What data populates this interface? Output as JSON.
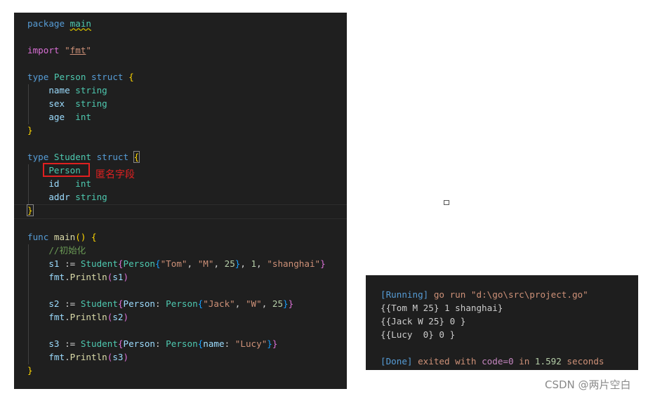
{
  "editor": {
    "lines": [
      [
        [
          "package ",
          "kw"
        ],
        [
          "main",
          "ty sq"
        ]
      ],
      [],
      [
        [
          "import ",
          "b2"
        ],
        [
          "\"",
          "st"
        ],
        [
          "fmt",
          "st ul"
        ],
        [
          "\"",
          "st"
        ]
      ],
      [],
      [
        [
          "type ",
          "kw"
        ],
        [
          "Person ",
          "ty"
        ],
        [
          "struct ",
          "kw"
        ],
        [
          "{",
          "b1"
        ]
      ],
      [
        [
          "    name ",
          "va"
        ],
        [
          "string",
          "ty"
        ]
      ],
      [
        [
          "    sex  ",
          "va"
        ],
        [
          "string",
          "ty"
        ]
      ],
      [
        [
          "    age  ",
          "va"
        ],
        [
          "int",
          "ty"
        ]
      ],
      [
        [
          "}",
          "b1"
        ]
      ],
      [],
      [
        [
          "type ",
          "kw"
        ],
        [
          "Student ",
          "ty"
        ],
        [
          "struct ",
          "kw"
        ],
        [
          "{",
          "b1 mb"
        ]
      ],
      [
        [
          "    Person",
          "ty"
        ]
      ],
      [
        [
          "    id   ",
          "va"
        ],
        [
          "int",
          "ty"
        ]
      ],
      [
        [
          "    addr ",
          "va"
        ],
        [
          "string",
          "ty"
        ]
      ],
      [
        [
          "}",
          "b1 mb"
        ]
      ],
      [],
      [
        [
          "func ",
          "kw"
        ],
        [
          "main",
          "fn"
        ],
        [
          "()",
          "b1"
        ],
        [
          " {",
          "b1"
        ]
      ],
      [
        [
          "    //初始化",
          "cm"
        ]
      ],
      [
        [
          "    s1 ",
          "va"
        ],
        [
          ":= ",
          "pl"
        ],
        [
          "Student",
          "ty"
        ],
        [
          "{",
          "b2"
        ],
        [
          "Person",
          "ty"
        ],
        [
          "{",
          "b3"
        ],
        [
          "\"Tom\"",
          "st"
        ],
        [
          ", ",
          "pl"
        ],
        [
          "\"M\"",
          "st"
        ],
        [
          ", ",
          "pl"
        ],
        [
          "25",
          "nu"
        ],
        [
          "}",
          "b3"
        ],
        [
          ", ",
          "pl"
        ],
        [
          "1",
          "nu"
        ],
        [
          ", ",
          "pl"
        ],
        [
          "\"shanghai\"",
          "st"
        ],
        [
          "}",
          "b2"
        ]
      ],
      [
        [
          "    fmt",
          "va"
        ],
        [
          ".",
          "pl"
        ],
        [
          "Println",
          "fn"
        ],
        [
          "(",
          "b2"
        ],
        [
          "s1",
          "va"
        ],
        [
          ")",
          "b2"
        ]
      ],
      [],
      [
        [
          "    s2 ",
          "va"
        ],
        [
          ":= ",
          "pl"
        ],
        [
          "Student",
          "ty"
        ],
        [
          "{",
          "b2"
        ],
        [
          "Person",
          "va"
        ],
        [
          ": ",
          "pl"
        ],
        [
          "Person",
          "ty"
        ],
        [
          "{",
          "b3"
        ],
        [
          "\"Jack\"",
          "st"
        ],
        [
          ", ",
          "pl"
        ],
        [
          "\"W\"",
          "st"
        ],
        [
          ", ",
          "pl"
        ],
        [
          "25",
          "nu"
        ],
        [
          "}",
          "b3"
        ],
        [
          "}",
          "b2"
        ]
      ],
      [
        [
          "    fmt",
          "va"
        ],
        [
          ".",
          "pl"
        ],
        [
          "Println",
          "fn"
        ],
        [
          "(",
          "b2"
        ],
        [
          "s2",
          "va"
        ],
        [
          ")",
          "b2"
        ]
      ],
      [],
      [
        [
          "    s3 ",
          "va"
        ],
        [
          ":= ",
          "pl"
        ],
        [
          "Student",
          "ty"
        ],
        [
          "{",
          "b2"
        ],
        [
          "Person",
          "va"
        ],
        [
          ": ",
          "pl"
        ],
        [
          "Person",
          "ty"
        ],
        [
          "{",
          "b3"
        ],
        [
          "name",
          "va"
        ],
        [
          ": ",
          "pl"
        ],
        [
          "\"Lucy\"",
          "st"
        ],
        [
          "}",
          "b3"
        ],
        [
          "}",
          "b2"
        ]
      ],
      [
        [
          "    fmt",
          "va"
        ],
        [
          ".",
          "pl"
        ],
        [
          "Println",
          "fn"
        ],
        [
          "(",
          "b2"
        ],
        [
          "s3",
          "va"
        ],
        [
          ")",
          "b2"
        ]
      ],
      [
        [
          "}",
          "b1"
        ]
      ]
    ],
    "annotation": "匿名字段"
  },
  "output": {
    "lines": [
      [
        [
          "[Running]",
          "ob"
        ],
        [
          " go run \"d:\\go\\src\\project.go\"",
          "oo"
        ]
      ],
      [
        [
          "{{Tom M 25} 1 shanghai}",
          ""
        ]
      ],
      [
        [
          "{{Jack W 25} 0 }",
          ""
        ]
      ],
      [
        [
          "{{Lucy  0} 0 }",
          ""
        ]
      ],
      [],
      [
        [
          "[Done]",
          "ob"
        ],
        [
          " exited with ",
          "oo"
        ],
        [
          "code=0",
          "op"
        ],
        [
          " in ",
          "oo"
        ],
        [
          "1.592",
          "og"
        ],
        [
          " seconds",
          "oo"
        ]
      ]
    ]
  },
  "watermark": "CSDN @两片空白",
  "colors": {
    "editor_bg": "#1f1f1f",
    "output_bg": "#1e1e1e",
    "annotation": "#e02020"
  }
}
